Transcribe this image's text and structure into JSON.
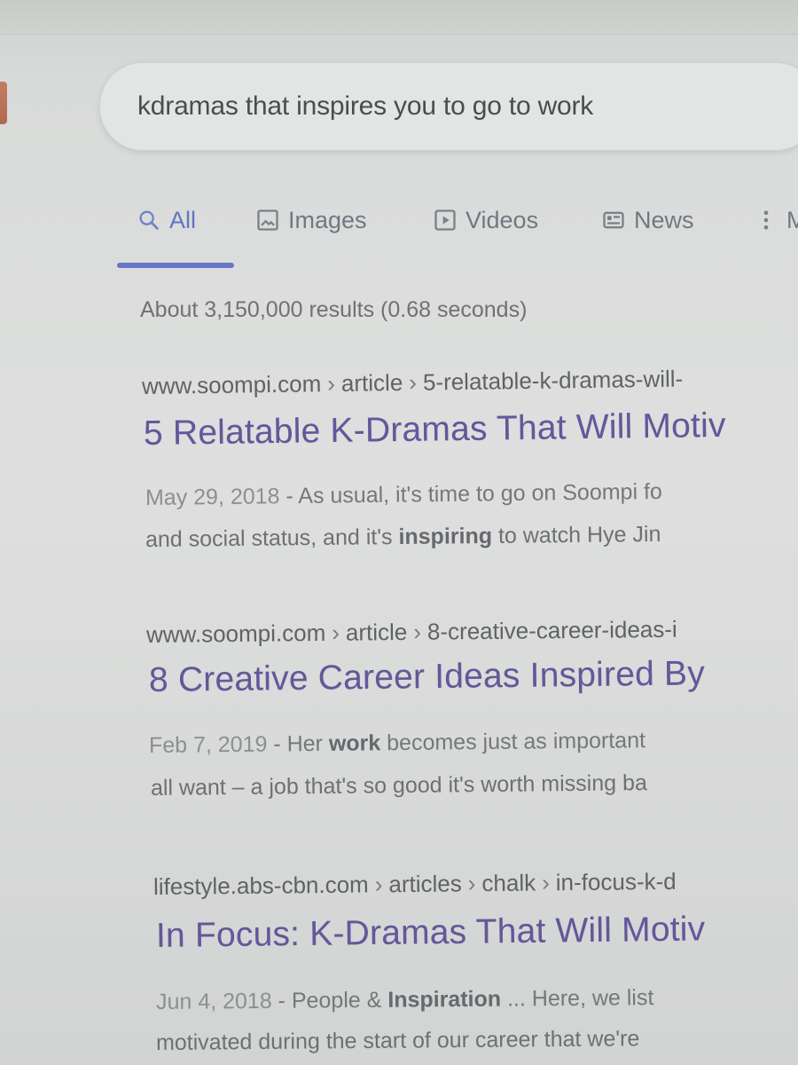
{
  "search": {
    "query": "kdramas that inspires you to go to work"
  },
  "tabs": [
    {
      "label": "All",
      "icon": "search-icon"
    },
    {
      "label": "Images",
      "icon": "image-icon"
    },
    {
      "label": "Videos",
      "icon": "play-icon"
    },
    {
      "label": "News",
      "icon": "news-icon"
    },
    {
      "label": "M",
      "icon": "more-vertical-icon"
    }
  ],
  "stats": "About 3,150,000 results (0.68 seconds)",
  "results": [
    {
      "site": "www.soompi.com",
      "path1": "article",
      "path2": "5-relatable-k-dramas-will-",
      "title": "5 Relatable K-Dramas That Will Motiv",
      "date": "May 29, 2018",
      "snippet_rest": " - As usual, it's time to go on Soompi fo",
      "line2_prefix": "and social status, and it's ",
      "line2_bold": "inspiring",
      "line2_suffix": " to watch Hye Jin"
    },
    {
      "site": "www.soompi.com",
      "path1": "article",
      "path2": "8-creative-career-ideas-i",
      "title": "8 Creative Career Ideas Inspired By",
      "date": "Feb 7, 2019",
      "snippet_rest": " - Her ",
      "snippet_bold": "work",
      "snippet_tail": " becomes just as important",
      "line2_text": "all want – a job that's so good it's worth missing ba"
    },
    {
      "site": "lifestyle.abs-cbn.com",
      "path1": "articles",
      "path2": "chalk",
      "path3": "in-focus-k-d",
      "title": "In Focus: K-Dramas That Will Motiv",
      "date": "Jun 4, 2018",
      "snippet_rest": " - People & ",
      "snippet_bold": "Inspiration",
      "snippet_tail": " ... Here, we list",
      "line2_text": "motivated during the start of our career that we're"
    }
  ]
}
